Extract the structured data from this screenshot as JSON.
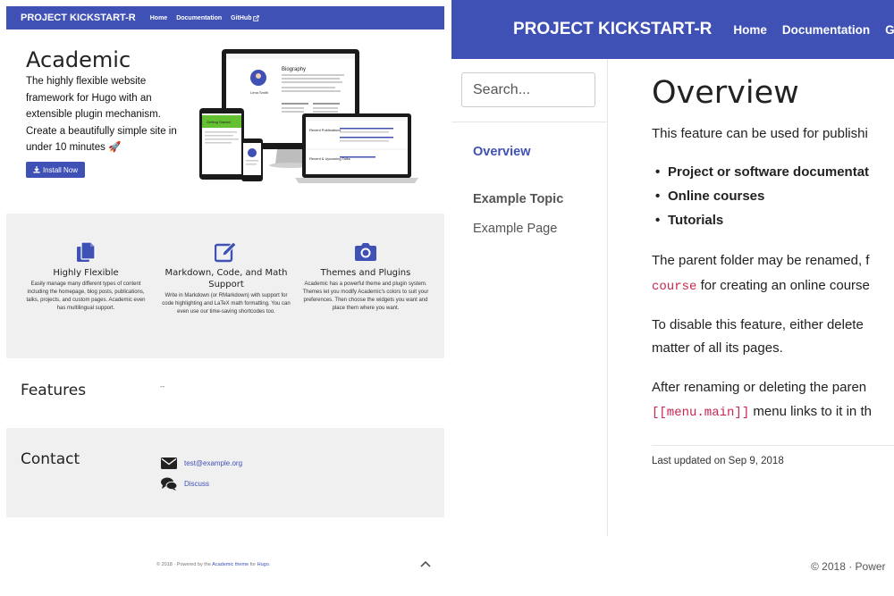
{
  "left": {
    "nav": {
      "brand": "PROJECT KICKSTART-R",
      "links": [
        "Home",
        "Documentation",
        "GitHub"
      ]
    },
    "hero": {
      "title": "Academic",
      "text": "The highly flexible website framework for Hugo with an extensible plugin mechanism. Create a beautifully simple site in under 10 minutes 🚀",
      "button": "Install Now"
    },
    "features": [
      {
        "title": "Highly Flexible",
        "icon": "file-copy-icon",
        "text": "Easily manage many different types of content including the homepage, blog posts, publications, talks, projects, and custom pages. Academic even has multilingual support."
      },
      {
        "title": "Markdown, Code, and Math Support",
        "icon": "edit-icon",
        "text": "Write in Markdown (or RMarkdown) with support for code highlighting and LaTeX math formatting. You can even use our time-saving shortcodes too."
      },
      {
        "title": "Themes and Plugins",
        "icon": "camera-icon",
        "text": "Academic has a powerful theme and plugin system. Themes let you modify Academic's colors to suit your preferences. Then choose the widgets you want and place them where you want."
      }
    ],
    "features_section": {
      "title": "Features",
      "placeholder": "--"
    },
    "contact": {
      "title": "Contact",
      "email": "test@example.org",
      "discuss": "Discuss"
    },
    "footer": {
      "prefix": "© 2018 · Powered by the ",
      "theme_link": "Academic theme",
      "middle": " for ",
      "hugo_link": "Hugo",
      "suffix": "."
    },
    "devices": {
      "bio_heading": "Biography",
      "person_name": "Lena Smith",
      "publications_heading": "Recent Publications",
      "talks_heading": "Recent & Upcoming Talks",
      "getting_started": "Getting Started"
    }
  },
  "right": {
    "nav": {
      "brand": "PROJECT KICKSTART-R",
      "links": [
        "Home",
        "Documentation",
        "Git"
      ]
    },
    "search": {
      "placeholder": "Search..."
    },
    "sidebar": {
      "active": "Overview",
      "topic": "Example Topic",
      "page": "Example Page"
    },
    "content": {
      "title": "Overview",
      "intro": "This feature can be used for publishi",
      "bullets": [
        "Project or software documentat",
        "Online courses",
        "Tutorials"
      ],
      "p2_line1": "The parent folder may be renamed, f",
      "p2_code": "course",
      "p2_line2_rest": " for creating an online course",
      "p3_line1": "To disable this feature, either delete",
      "p3_line2": "matter of all its pages.",
      "p4_line1": "After renaming or deleting the paren",
      "p4_code": "[[menu.main]]",
      "p4_line2_rest": " menu links to it in th",
      "updated": "Last updated on Sep 9, 2018",
      "footer": "© 2018 · Power"
    }
  },
  "colors": {
    "brand": "#3f51b5",
    "code": "#c7254e",
    "gray_section": "#f0f0f0"
  }
}
